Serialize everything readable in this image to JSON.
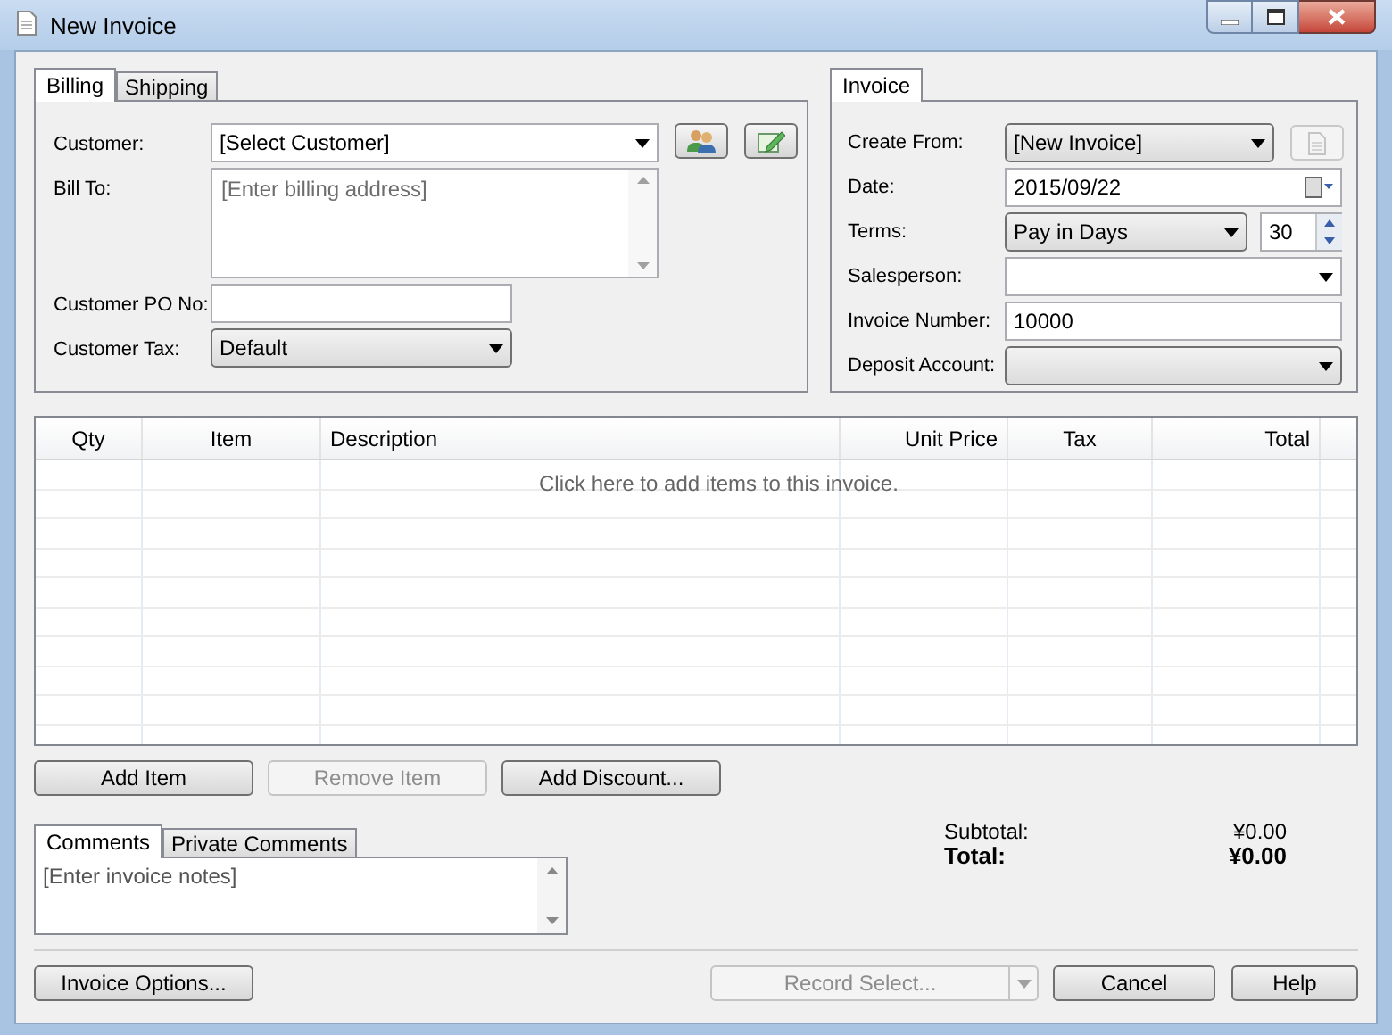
{
  "window": {
    "title": "New Invoice"
  },
  "billing": {
    "tabs": [
      {
        "label": "Billing",
        "selected": true
      },
      {
        "label": "Shipping",
        "selected": false
      }
    ],
    "fields": [
      {
        "kind": "customer",
        "label": "Customer:",
        "value": "[Select Customer]"
      },
      {
        "kind": "textarea",
        "label": "Bill To:",
        "placeholder": "[Enter billing address]"
      },
      {
        "kind": "text",
        "label": "Customer PO No:"
      },
      {
        "kind": "dropdown",
        "label": "Customer Tax:",
        "value": "Default"
      }
    ]
  },
  "invoice": {
    "tabs": [
      {
        "label": "Invoice",
        "selected": true
      }
    ],
    "fields": [
      {
        "kind": "template",
        "label": "Create From:",
        "value": "[New Invoice]"
      },
      {
        "kind": "date",
        "label": "Date:",
        "value": "2015/09/22"
      },
      {
        "kind": "terms",
        "label": "Terms:",
        "value": "Pay in Days",
        "days": "30"
      },
      {
        "kind": "combo",
        "label": "Salesperson:"
      },
      {
        "kind": "text",
        "label": "Invoice Number:",
        "value": "10000"
      },
      {
        "kind": "dropdown",
        "label": "Deposit Account:"
      }
    ]
  },
  "items_table": {
    "columns": [
      "Qty",
      "Item",
      "Description",
      "Unit Price",
      "Tax",
      "Total"
    ],
    "empty_message": "Click here to add items to this invoice."
  },
  "item_buttons": [
    {
      "label": "Add Item",
      "disabled": false
    },
    {
      "label": "Remove Item",
      "disabled": true
    },
    {
      "label": "Add Discount...",
      "disabled": false
    }
  ],
  "comments": {
    "tabs": [
      {
        "label": "Comments",
        "selected": true
      },
      {
        "label": "Private Comments",
        "selected": false
      }
    ],
    "placeholder": "[Enter invoice notes]"
  },
  "totals": [
    {
      "kind": "subtotal",
      "label": "Subtotal:",
      "value": "¥0.00"
    },
    {
      "kind": "total",
      "label": "Total:",
      "value": "¥0.00"
    }
  ],
  "footer": {
    "options_button": "Invoice Options...",
    "record_select": {
      "label": "Record Select...",
      "disabled": true
    },
    "buttons": [
      "Cancel",
      "Help"
    ]
  }
}
